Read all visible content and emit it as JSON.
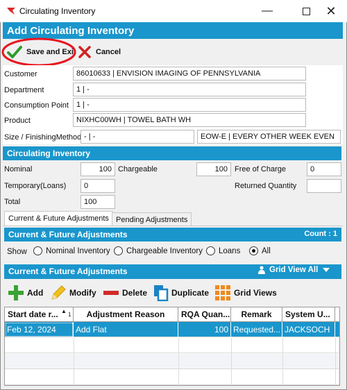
{
  "window": {
    "title": "Circulating Inventory"
  },
  "header": {
    "title": "Add Circulating Inventory"
  },
  "toolbar": {
    "save_label": "Save and Exit",
    "cancel_label": "Cancel"
  },
  "form": {
    "customer": {
      "label": "Customer",
      "value": "86010633            | ENVISION IMAGING OF PENNSYLVANIA"
    },
    "department": {
      "label": "Department",
      "value": "1                         | -"
    },
    "consumption_point": {
      "label": "Consumption Point",
      "value": "1    | -"
    },
    "product": {
      "label": "Product",
      "value": "NIXHC00WH       | TOWEL BATH WH"
    },
    "size_finishing": {
      "label": "Size / FinishingMethod",
      "value1": "-             | -",
      "value2": "EOW-E    | EVERY OTHER WEEK EVEN"
    }
  },
  "circulating": {
    "section_title": "Circulating Inventory",
    "nominal_label": "Nominal",
    "nominal_value": "100",
    "chargeable_label": "Chargeable",
    "chargeable_value": "100",
    "free_label": "Free of Charge",
    "free_value": "0",
    "temporary_label": "Temporary(Loans)",
    "temporary_value": "0",
    "returned_label": "Returned Quantity",
    "returned_value": "",
    "total_label": "Total",
    "total_value": "100"
  },
  "tabs": [
    {
      "label": "Current & Future Adjustments",
      "active": true
    },
    {
      "label": "Pending Adjustments",
      "active": false
    }
  ],
  "adjustments": {
    "section_title": "Current & Future Adjustments",
    "count_label": "Count : 1",
    "show_label": "Show",
    "filters": [
      {
        "label": "Nominal Inventory",
        "selected": false
      },
      {
        "label": "Chargeable Inventory",
        "selected": false
      },
      {
        "label": "Loans",
        "selected": false
      },
      {
        "label": "All",
        "selected": true
      }
    ],
    "grid_title": "Current & Future Adjustments",
    "grid_view_label": "Grid View All",
    "actions": {
      "add": "Add",
      "modify": "Modify",
      "delete": "Delete",
      "duplicate": "Duplicate",
      "grid_views": "Grid Views"
    },
    "columns": [
      "Start date r...",
      "Adjustment Reason",
      "RQA Quan...",
      "Remark",
      "System U..."
    ],
    "sort_indicator": "1",
    "rows": [
      {
        "start_date": "Feb 12, 2024",
        "reason": "Add Flat",
        "rqa": "100",
        "remark": "Requested...",
        "user": "JACKSOCH"
      }
    ]
  },
  "colors": {
    "accent": "#1a96cc",
    "selected_row": "#1a96cc",
    "save_green": "#2e9a2e",
    "cancel_red": "#d42020",
    "highlight_circle": "#e8141e"
  }
}
